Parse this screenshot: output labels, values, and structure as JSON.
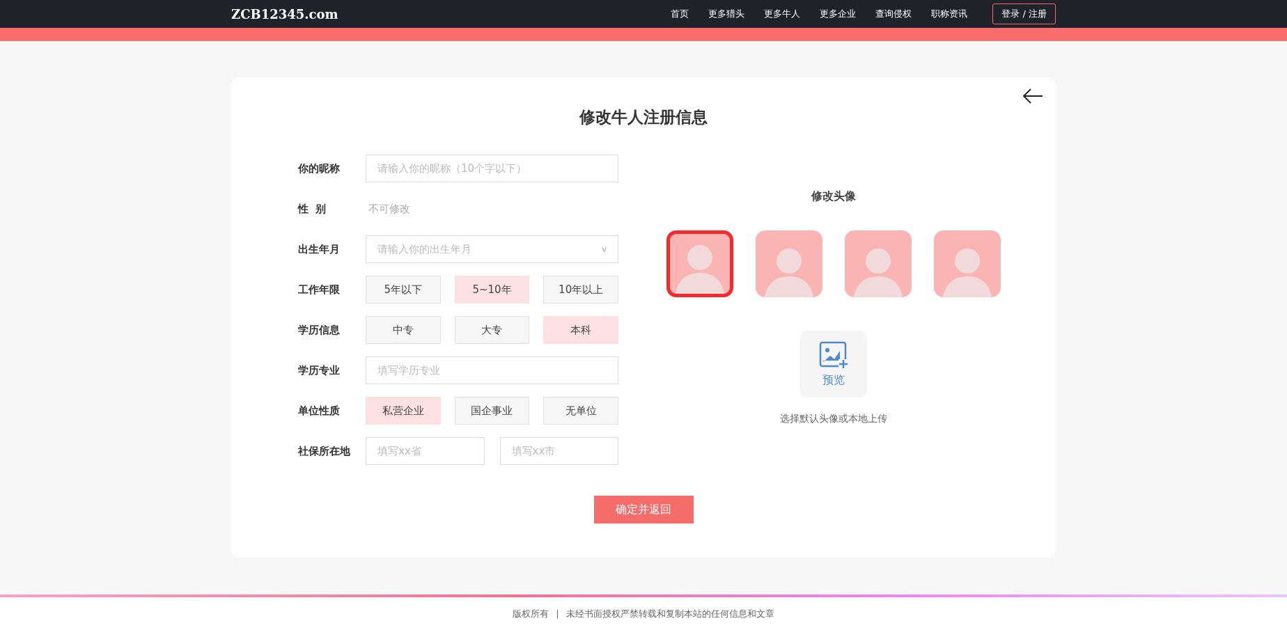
{
  "header": {
    "logo": "ZCB12345.com",
    "nav": [
      {
        "label": "首页"
      },
      {
        "label": "更多猎头"
      },
      {
        "label": "更多牛人"
      },
      {
        "label": "更多企业"
      },
      {
        "label": "查询侵权"
      },
      {
        "label": "职称资讯"
      }
    ],
    "login_button": "登录 / 注册"
  },
  "form": {
    "title": "修改牛人注册信息",
    "fields": [
      {
        "kind": "text",
        "label": "你的昵称",
        "placeholder": "请输入你的昵称（10个字以下）"
      },
      {
        "kind": "static",
        "label": "性  别",
        "value": "不可修改"
      },
      {
        "kind": "select",
        "label": "出生年月",
        "placeholder": "请输入你的出生年月",
        "caret": "v"
      },
      {
        "kind": "options",
        "label": "工作年限",
        "options": [
          {
            "label": "5年以下",
            "selected": false
          },
          {
            "label": "5~10年",
            "selected": true
          },
          {
            "label": "10年以上",
            "selected": false
          }
        ]
      },
      {
        "kind": "options",
        "label": "学历信息",
        "options": [
          {
            "label": "中专",
            "selected": false
          },
          {
            "label": "大专",
            "selected": false
          },
          {
            "label": "本科",
            "selected": true
          }
        ]
      },
      {
        "kind": "text",
        "label": "学历专业",
        "placeholder": "填写学历专业"
      },
      {
        "kind": "options",
        "label": "单位性质",
        "options": [
          {
            "label": "私营企业",
            "selected": true
          },
          {
            "label": "国企事业",
            "selected": false
          },
          {
            "label": "无单位",
            "selected": false
          }
        ]
      },
      {
        "kind": "pair",
        "label": "社保所在地",
        "placeholders": [
          "填写xx省",
          "填写xx市"
        ]
      }
    ]
  },
  "avatar": {
    "title": "修改头像",
    "avatars": [
      {
        "selected": true
      },
      {
        "selected": false
      },
      {
        "selected": false
      },
      {
        "selected": false
      }
    ],
    "upload_label": "预览",
    "hint": "选择默认头像或本地上传"
  },
  "submit": "确定并返回",
  "footer": {
    "copyright": "版权所有",
    "separator": "|",
    "notice": "未经书面授权严禁转载和复制本站的任何信息和文章"
  }
}
